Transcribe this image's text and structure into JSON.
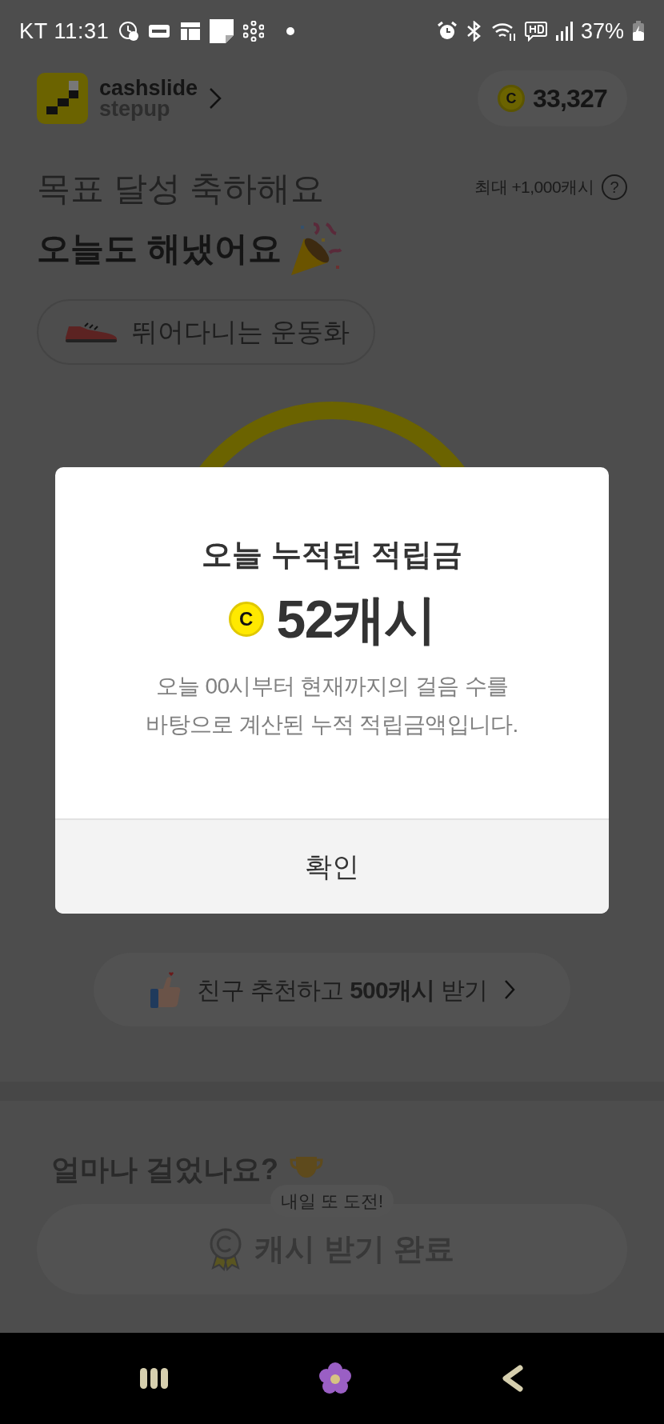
{
  "status_bar": {
    "carrier_time": "KT 11:31",
    "battery": "37%"
  },
  "header": {
    "brand_top": "cashslide",
    "brand_bottom": "stepup",
    "coin_symbol": "C",
    "balance": "33,327"
  },
  "goal": {
    "title": "목표 달성 축하해요",
    "subtitle": "오늘도 해냈어요",
    "max_reward": "최대 +1,000캐시",
    "help": "?"
  },
  "shoe_chip": {
    "label": "뛰어다니는 운동화"
  },
  "invite": {
    "label": "친구 추천하고 **500캐시** 받기"
  },
  "stats": {
    "heading": "얼마나 걸었나요?"
  },
  "tooltip": "내일 또 도전!",
  "claim_button": {
    "label": "캐시 받기 완료",
    "disabled": true
  },
  "dialog": {
    "title": "오늘 누적된 적립금",
    "coin_symbol": "C",
    "amount": "52캐시",
    "description": [
      "오늘 00시부터 현재까지의 걸음 수를",
      "바탕으로 계산된 누적 적립금액입니다."
    ],
    "confirm": "확인"
  }
}
